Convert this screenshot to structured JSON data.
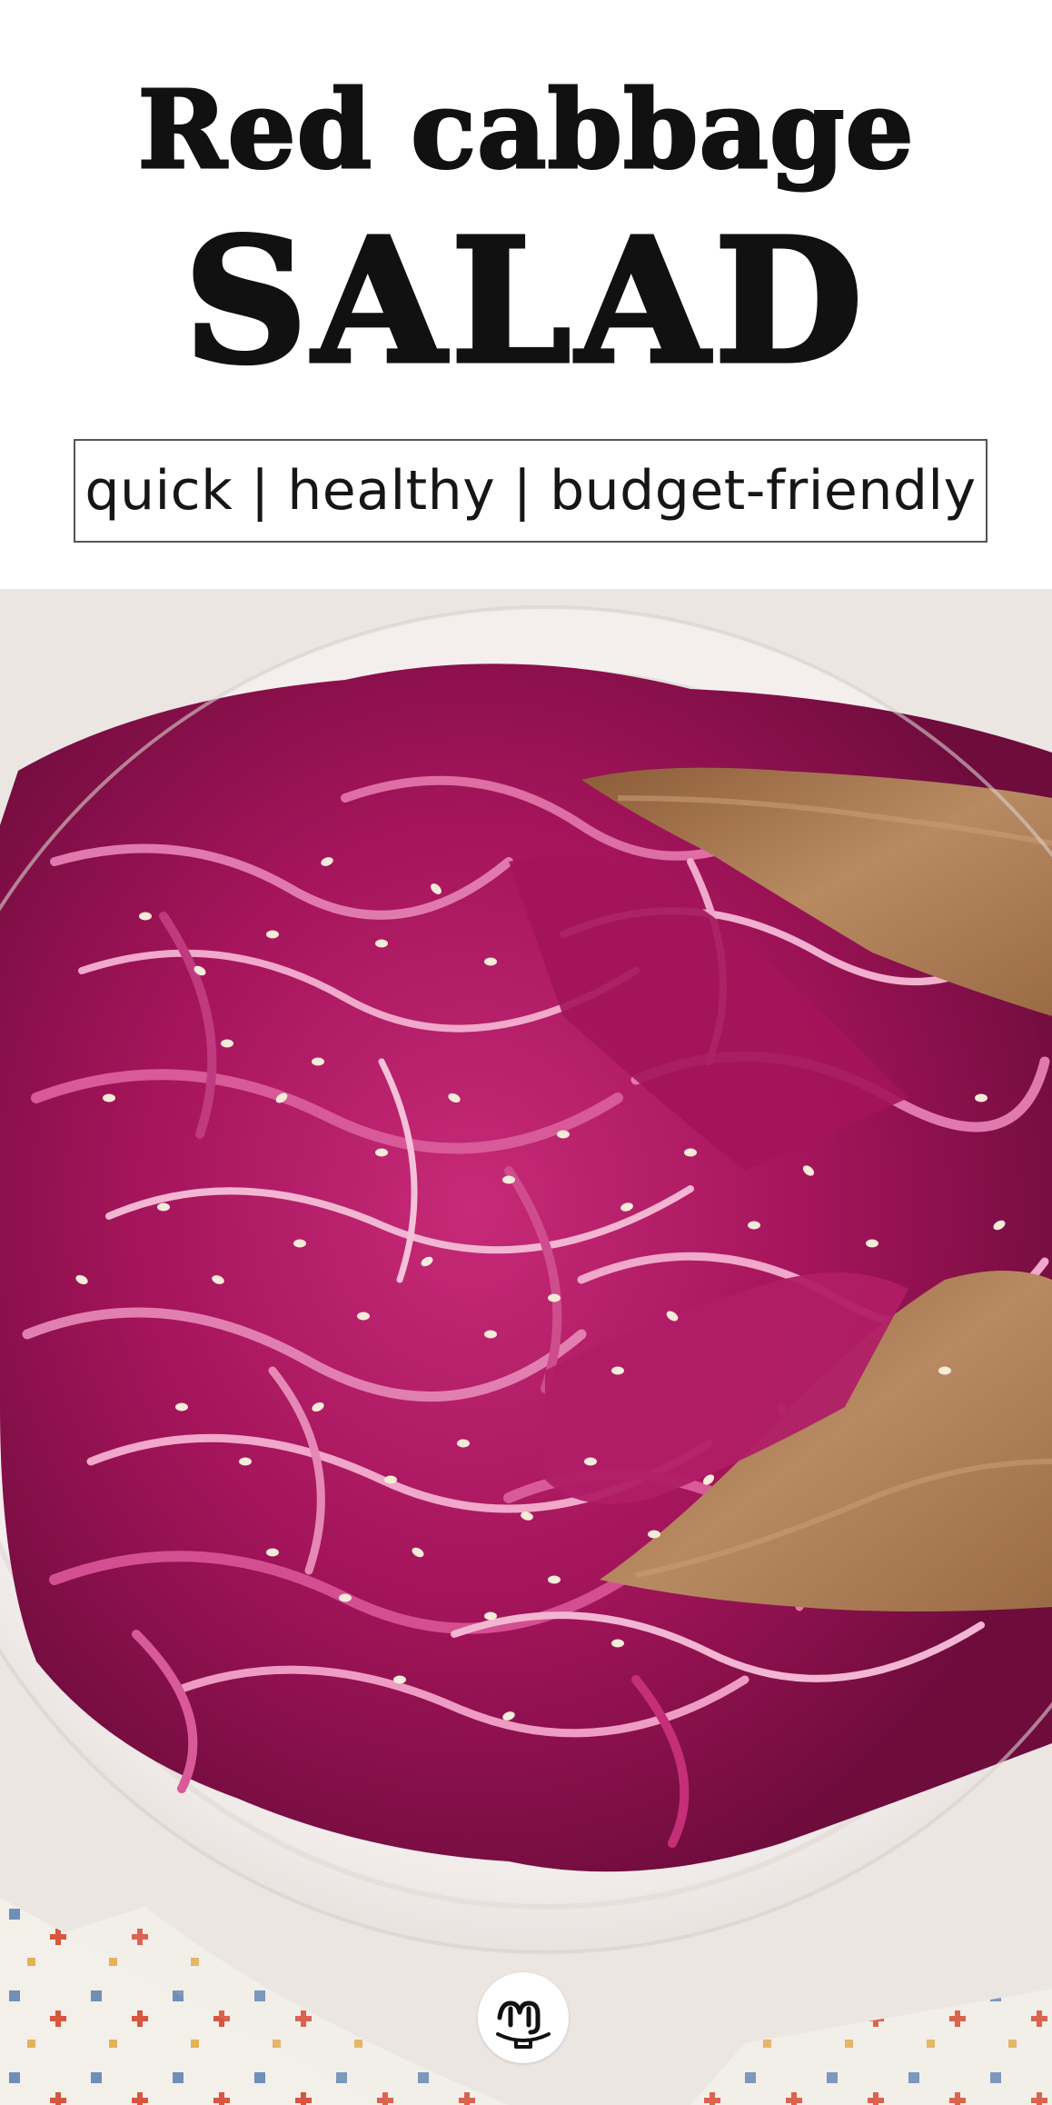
{
  "header": {
    "title_line1": "Red cabbage",
    "title_line2": "SALAD",
    "tagline": "quick | healthy | budget-friendly"
  },
  "photo": {
    "subject": "red-cabbage-salad-photo",
    "colors": {
      "cabbage": "#b0175f",
      "bowl": "#f6f2f0",
      "spoon": "#a5764f",
      "seeds": "#f4ecd9",
      "background": "#ece6e3"
    }
  },
  "logo": {
    "icon": "brand-logo-icon"
  }
}
